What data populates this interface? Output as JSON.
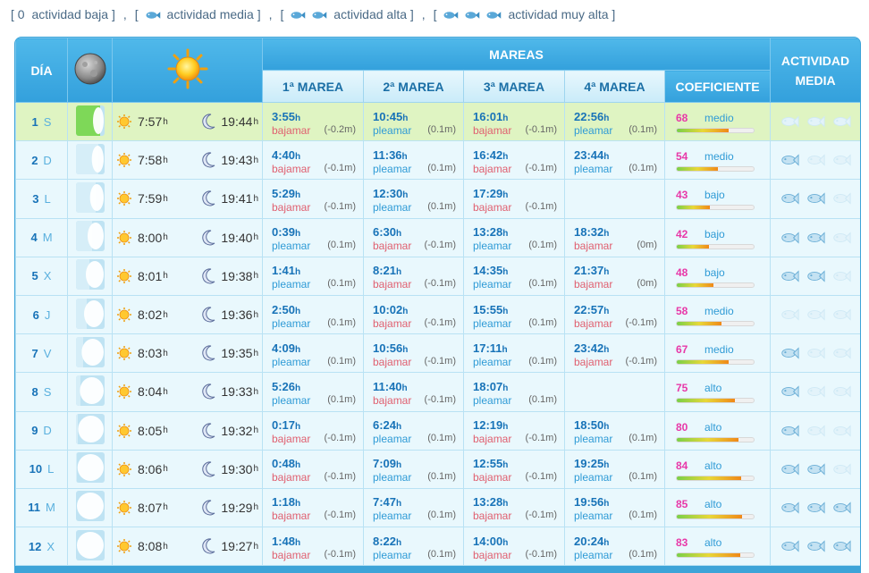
{
  "legend": [
    {
      "prefix": "[",
      "count": "0",
      "label": "actividad baja",
      "suffix": "]",
      "fish": 0
    },
    {
      "prefix": "[",
      "label": "actividad media",
      "suffix": "]",
      "fish": 1
    },
    {
      "prefix": "[",
      "label": "actividad alta",
      "suffix": "]",
      "fish": 2
    },
    {
      "prefix": "[",
      "label": "actividad muy alta",
      "suffix": "]",
      "fish": 3
    }
  ],
  "legend_separator": ",",
  "header": {
    "day": "DÍA",
    "mareas": "MAREAS",
    "marea1": "1ª MAREA",
    "marea2": "2ª MAREA",
    "marea3": "3ª MAREA",
    "marea4": "4ª MAREA",
    "coeficiente": "COEFICIENTE",
    "actividad": "ACTIVIDAD MEDIA"
  },
  "units": {
    "hour": "h"
  },
  "colors": {
    "accent": "#3da4d8",
    "today_row": "#dff4c2",
    "pleamar": "#2f9bd6",
    "bajamar": "#e06070",
    "coef_number": "#e838a8"
  },
  "rows": [
    {
      "day": "1",
      "wd": "S",
      "today": true,
      "moon_phase": 0.95,
      "sunrise": "7:57",
      "sunset": "19:44",
      "tides": [
        {
          "time": "3:55",
          "type": "bajamar",
          "height": "(-0.2m)"
        },
        {
          "time": "10:45",
          "type": "pleamar",
          "height": "(0.1m)"
        },
        {
          "time": "16:01",
          "type": "bajamar",
          "height": "(-0.1m)"
        },
        {
          "time": "22:56",
          "type": "pleamar",
          "height": "(0.1m)"
        }
      ],
      "coef": "68",
      "coef_word": "medio",
      "coef_level": 0.68,
      "activity": 0
    },
    {
      "day": "2",
      "wd": "D",
      "moon_phase": 0.88,
      "sunrise": "7:58",
      "sunset": "19:43",
      "tides": [
        {
          "time": "4:40",
          "type": "bajamar",
          "height": "(-0.1m)"
        },
        {
          "time": "11:36",
          "type": "pleamar",
          "height": "(0.1m)"
        },
        {
          "time": "16:42",
          "type": "bajamar",
          "height": "(-0.1m)"
        },
        {
          "time": "23:44",
          "type": "pleamar",
          "height": "(0.1m)"
        }
      ],
      "coef": "54",
      "coef_word": "medio",
      "coef_level": 0.54,
      "activity": 1
    },
    {
      "day": "3",
      "wd": "L",
      "moon_phase": 0.78,
      "sunrise": "7:59",
      "sunset": "19:41",
      "tides": [
        {
          "time": "5:29",
          "type": "bajamar",
          "height": "(-0.1m)"
        },
        {
          "time": "12:30",
          "type": "pleamar",
          "height": "(0.1m)"
        },
        {
          "time": "17:29",
          "type": "bajamar",
          "height": "(-0.1m)"
        }
      ],
      "coef": "43",
      "coef_word": "bajo",
      "coef_level": 0.43,
      "activity": 2
    },
    {
      "day": "4",
      "wd": "M",
      "moon_phase": 0.66,
      "sunrise": "8:00",
      "sunset": "19:40",
      "tides": [
        {
          "time": "0:39",
          "type": "pleamar",
          "height": "(0.1m)"
        },
        {
          "time": "6:30",
          "type": "bajamar",
          "height": "(-0.1m)"
        },
        {
          "time": "13:28",
          "type": "pleamar",
          "height": "(0.1m)"
        },
        {
          "time": "18:32",
          "type": "bajamar",
          "height": "(0m)"
        }
      ],
      "coef": "42",
      "coef_word": "bajo",
      "coef_level": 0.42,
      "activity": 2
    },
    {
      "day": "5",
      "wd": "X",
      "moon_phase": 0.54,
      "sunrise": "8:01",
      "sunset": "19:38",
      "tides": [
        {
          "time": "1:41",
          "type": "pleamar",
          "height": "(0.1m)"
        },
        {
          "time": "8:21",
          "type": "bajamar",
          "height": "(-0.1m)"
        },
        {
          "time": "14:35",
          "type": "pleamar",
          "height": "(0.1m)"
        },
        {
          "time": "21:37",
          "type": "bajamar",
          "height": "(0m)"
        }
      ],
      "coef": "48",
      "coef_word": "bajo",
      "coef_level": 0.48,
      "activity": 2
    },
    {
      "day": "6",
      "wd": "J",
      "moon_phase": 0.42,
      "sunrise": "8:02",
      "sunset": "19:36",
      "tides": [
        {
          "time": "2:50",
          "type": "pleamar",
          "height": "(0.1m)"
        },
        {
          "time": "10:02",
          "type": "bajamar",
          "height": "(-0.1m)"
        },
        {
          "time": "15:55",
          "type": "pleamar",
          "height": "(0.1m)"
        },
        {
          "time": "22:57",
          "type": "bajamar",
          "height": "(-0.1m)"
        }
      ],
      "coef": "58",
      "coef_word": "medio",
      "coef_level": 0.58,
      "activity": 0
    },
    {
      "day": "7",
      "wd": "V",
      "moon_phase": 0.3,
      "sunrise": "8:03",
      "sunset": "19:35",
      "tides": [
        {
          "time": "4:09",
          "type": "pleamar",
          "height": "(0.1m)"
        },
        {
          "time": "10:56",
          "type": "bajamar",
          "height": "(-0.1m)"
        },
        {
          "time": "17:11",
          "type": "pleamar",
          "height": "(0.1m)"
        },
        {
          "time": "23:42",
          "type": "bajamar",
          "height": "(-0.1m)"
        }
      ],
      "coef": "67",
      "coef_word": "medio",
      "coef_level": 0.67,
      "activity": 1
    },
    {
      "day": "8",
      "wd": "S",
      "moon_phase": 0.18,
      "sunrise": "8:04",
      "sunset": "19:33",
      "tides": [
        {
          "time": "5:26",
          "type": "pleamar",
          "height": "(0.1m)"
        },
        {
          "time": "11:40",
          "type": "bajamar",
          "height": "(-0.1m)"
        },
        {
          "time": "18:07",
          "type": "pleamar",
          "height": "(0.1m)"
        }
      ],
      "coef": "75",
      "coef_word": "alto",
      "coef_level": 0.75,
      "activity": 1
    },
    {
      "day": "9",
      "wd": "D",
      "moon_phase": 0.08,
      "sunrise": "8:05",
      "sunset": "19:32",
      "tides": [
        {
          "time": "0:17",
          "type": "bajamar",
          "height": "(-0.1m)"
        },
        {
          "time": "6:24",
          "type": "pleamar",
          "height": "(0.1m)"
        },
        {
          "time": "12:19",
          "type": "bajamar",
          "height": "(-0.1m)"
        },
        {
          "time": "18:50",
          "type": "pleamar",
          "height": "(0.1m)"
        }
      ],
      "coef": "80",
      "coef_word": "alto",
      "coef_level": 0.8,
      "activity": 1
    },
    {
      "day": "10",
      "wd": "L",
      "moon_phase": 0.03,
      "sunrise": "8:06",
      "sunset": "19:30",
      "tides": [
        {
          "time": "0:48",
          "type": "bajamar",
          "height": "(-0.1m)"
        },
        {
          "time": "7:09",
          "type": "pleamar",
          "height": "(0.1m)"
        },
        {
          "time": "12:55",
          "type": "bajamar",
          "height": "(-0.1m)"
        },
        {
          "time": "19:25",
          "type": "pleamar",
          "height": "(0.1m)"
        }
      ],
      "coef": "84",
      "coef_word": "alto",
      "coef_level": 0.84,
      "activity": 2
    },
    {
      "day": "11",
      "wd": "M",
      "moon_phase": 0.0,
      "sunrise": "8:07",
      "sunset": "19:29",
      "tides": [
        {
          "time": "1:18",
          "type": "bajamar",
          "height": "(-0.1m)"
        },
        {
          "time": "7:47",
          "type": "pleamar",
          "height": "(0.1m)"
        },
        {
          "time": "13:28",
          "type": "bajamar",
          "height": "(-0.1m)"
        },
        {
          "time": "19:56",
          "type": "pleamar",
          "height": "(0.1m)"
        }
      ],
      "coef": "85",
      "coef_word": "alto",
      "coef_level": 0.85,
      "activity": 3
    },
    {
      "day": "12",
      "wd": "X",
      "moon_phase": 0.0,
      "sunrise": "8:08",
      "sunset": "19:27",
      "tides": [
        {
          "time": "1:48",
          "type": "bajamar",
          "height": "(-0.1m)"
        },
        {
          "time": "8:22",
          "type": "pleamar",
          "height": "(0.1m)"
        },
        {
          "time": "14:00",
          "type": "bajamar",
          "height": "(-0.1m)"
        },
        {
          "time": "20:24",
          "type": "pleamar",
          "height": "(0.1m)"
        }
      ],
      "coef": "83",
      "coef_word": "alto",
      "coef_level": 0.83,
      "activity": 3
    }
  ]
}
